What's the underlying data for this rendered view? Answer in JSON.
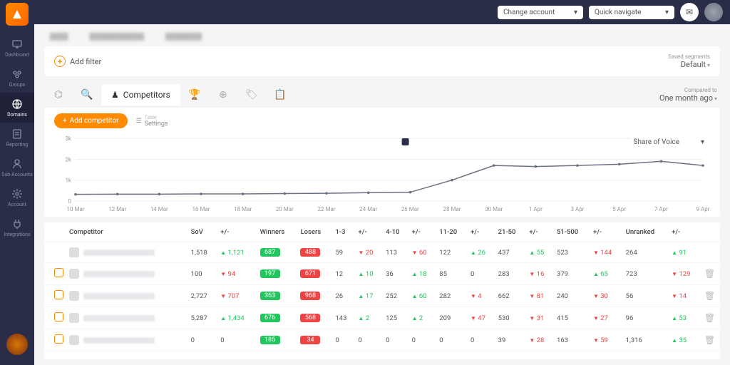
{
  "topbar": {
    "change_account": "Change account",
    "quick_navigate": "Quick navigate"
  },
  "sidebar": {
    "items": [
      {
        "label": "Dashboard"
      },
      {
        "label": "Groups"
      },
      {
        "label": "Domains"
      },
      {
        "label": "Reporting"
      },
      {
        "label": "Sub-Accounts"
      },
      {
        "label": "Account"
      },
      {
        "label": "Integrations"
      }
    ]
  },
  "filter": {
    "add_label": "Add filter",
    "segments_label": "Saved segments",
    "segments_value": "Default"
  },
  "tabs": {
    "active_label": "Competitors",
    "compare_label": "Compared to",
    "compare_value": "One month ago"
  },
  "toolbar": {
    "add_competitor": "Add competitor",
    "settings_key": "Table",
    "settings_label": "Settings",
    "chart_metric": "Share of Voice"
  },
  "chart_data": {
    "type": "line",
    "xlabel": "",
    "ylabel": "",
    "ylim": [
      0,
      3000
    ],
    "yticks": [
      "0",
      "1k",
      "2k",
      "3k"
    ],
    "categories": [
      "10 Mar",
      "12 Mar",
      "14 Mar",
      "16 Mar",
      "18 Mar",
      "20 Mar",
      "22 Mar",
      "24 Mar",
      "26 Mar",
      "28 Mar",
      "30 Mar",
      "1 Apr",
      "3 Apr",
      "5 Apr",
      "7 Apr",
      "9 Apr"
    ],
    "values": [
      320,
      330,
      330,
      340,
      340,
      360,
      370,
      400,
      420,
      1000,
      1700,
      1650,
      1700,
      1760,
      1900,
      1700
    ]
  },
  "table": {
    "headers": [
      "Competitor",
      "SoV",
      "+/-",
      "Winners",
      "Losers",
      "1-3",
      "+/-",
      "4-10",
      "+/-",
      "11-20",
      "+/-",
      "21-50",
      "+/-",
      "51-500",
      "+/-",
      "Unranked",
      "+/-"
    ],
    "rows": [
      {
        "own": true,
        "sov": "1,518",
        "sov_d": {
          "v": "1,121",
          "dir": "up"
        },
        "win": "687",
        "lose": "488",
        "r1": "59",
        "r1d": {
          "v": "20",
          "dir": "dn"
        },
        "r4": "113",
        "r4d": {
          "v": "60",
          "dir": "dn"
        },
        "r11": "122",
        "r11d": {
          "v": "26",
          "dir": "up"
        },
        "r21": "437",
        "r21d": {
          "v": "55",
          "dir": "up"
        },
        "r51": "523",
        "r51d": {
          "v": "144",
          "dir": "dn"
        },
        "unr": "264",
        "unrd": {
          "v": "91",
          "dir": "up"
        }
      },
      {
        "own": false,
        "sov": "100",
        "sov_d": {
          "v": "94",
          "dir": "dn"
        },
        "win": "197",
        "lose": "671",
        "r1": "12",
        "r1d": {
          "v": "10",
          "dir": "up"
        },
        "r4": "36",
        "r4d": {
          "v": "18",
          "dir": "up"
        },
        "r11": "85",
        "r11d": {
          "v": "0",
          "dir": ""
        },
        "r21": "283",
        "r21d": {
          "v": "16",
          "dir": "dn"
        },
        "r51": "379",
        "r51d": {
          "v": "65",
          "dir": "up"
        },
        "unr": "723",
        "unrd": {
          "v": "129",
          "dir": "dn"
        }
      },
      {
        "own": false,
        "sov": "2,727",
        "sov_d": {
          "v": "707",
          "dir": "dn"
        },
        "win": "363",
        "lose": "968",
        "r1": "26",
        "r1d": {
          "v": "17",
          "dir": "up"
        },
        "r4": "252",
        "r4d": {
          "v": "60",
          "dir": "up"
        },
        "r11": "282",
        "r11d": {
          "v": "4",
          "dir": "dn"
        },
        "r21": "662",
        "r21d": {
          "v": "81",
          "dir": "dn"
        },
        "r51": "240",
        "r51d": {
          "v": "30",
          "dir": "dn"
        },
        "unr": "56",
        "unrd": {
          "v": "14",
          "dir": "dn"
        }
      },
      {
        "own": false,
        "sov": "5,287",
        "sov_d": {
          "v": "1,434",
          "dir": "up"
        },
        "win": "676",
        "lose": "568",
        "r1": "143",
        "r1d": {
          "v": "2",
          "dir": "up"
        },
        "r4": "125",
        "r4d": {
          "v": "2",
          "dir": "up"
        },
        "r11": "209",
        "r11d": {
          "v": "47",
          "dir": "dn"
        },
        "r21": "530",
        "r21d": {
          "v": "31",
          "dir": "dn"
        },
        "r51": "415",
        "r51d": {
          "v": "27",
          "dir": "dn"
        },
        "unr": "96",
        "unrd": {
          "v": "53",
          "dir": "up"
        }
      },
      {
        "own": false,
        "sov": "0",
        "sov_d": {
          "v": "0",
          "dir": ""
        },
        "win": "185",
        "lose": "34",
        "r1": "0",
        "r1d": {
          "v": "0",
          "dir": ""
        },
        "r4": "0",
        "r4d": {
          "v": "0",
          "dir": ""
        },
        "r11": "0",
        "r11d": {
          "v": "0",
          "dir": ""
        },
        "r21": "39",
        "r21d": {
          "v": "28",
          "dir": "dn"
        },
        "r51": "163",
        "r51d": {
          "v": "59",
          "dir": "dn"
        },
        "unr": "1,316",
        "unrd": {
          "v": "35",
          "dir": "up"
        }
      }
    ]
  }
}
